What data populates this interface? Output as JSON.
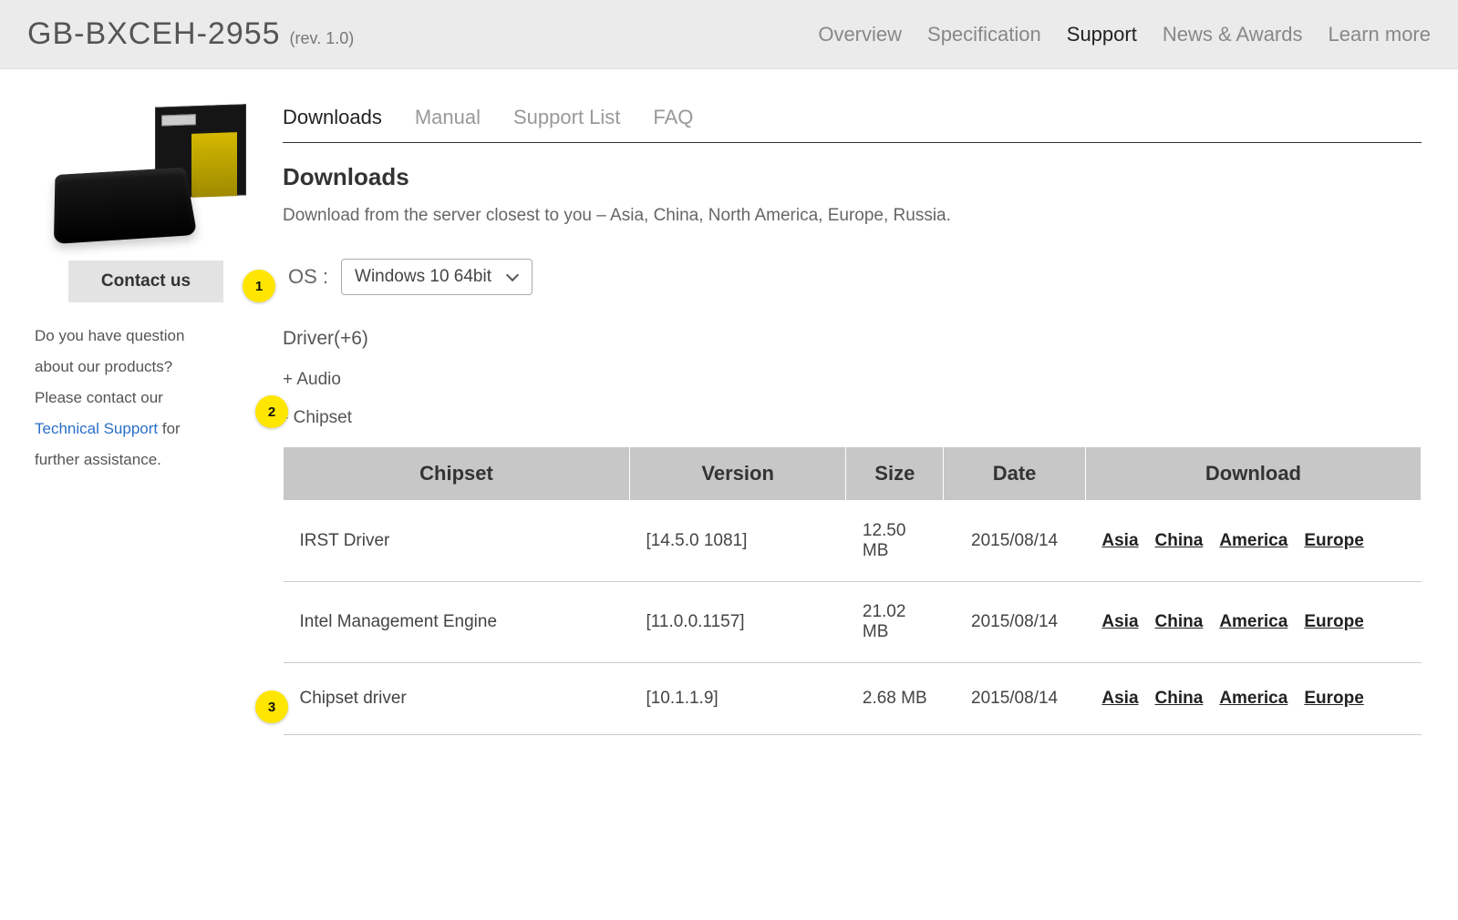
{
  "header": {
    "model": "GB-BXCEH-2955",
    "revision": "(rev. 1.0)",
    "nav": [
      "Overview",
      "Specification",
      "Support",
      "News & Awards",
      "Learn more"
    ],
    "nav_active": 2
  },
  "sidebar": {
    "contact_label": "Contact us",
    "q1": "Do you have question",
    "q2": "about our products?",
    "q3": "Please contact our",
    "tech_link": "Technical Support",
    "q4_tail": " for",
    "q5": "further assistance."
  },
  "subtabs": {
    "items": [
      "Downloads",
      "Manual",
      "Support List",
      "FAQ"
    ],
    "active": 0
  },
  "downloads": {
    "title": "Downloads",
    "subtitle": "Download from the server closest to you – Asia, China, North America, Europe, Russia.",
    "os_label": "OS :",
    "os_value": "Windows 10 64bit",
    "driver_heading": "Driver(+6)",
    "cat_audio": "+ Audio",
    "cat_chipset": "- Chipset",
    "table": {
      "headers": [
        "Chipset",
        "Version",
        "Size",
        "Date",
        "Download"
      ],
      "rows": [
        {
          "name": "IRST Driver",
          "version": "[14.5.0 1081]",
          "size": "12.50 MB",
          "date": "2015/08/14",
          "links": [
            "Asia",
            "China",
            "America",
            "Europe"
          ]
        },
        {
          "name": "Intel Management Engine",
          "version": "[11.0.0.1157]",
          "size": "21.02 MB",
          "date": "2015/08/14",
          "links": [
            "Asia",
            "China",
            "America",
            "Europe"
          ]
        },
        {
          "name": "Chipset driver",
          "version": "[10.1.1.9]",
          "size": "2.68 MB",
          "date": "2015/08/14",
          "links": [
            "Asia",
            "China",
            "America",
            "Europe"
          ]
        }
      ]
    }
  },
  "annotations": [
    "1",
    "2",
    "3"
  ]
}
